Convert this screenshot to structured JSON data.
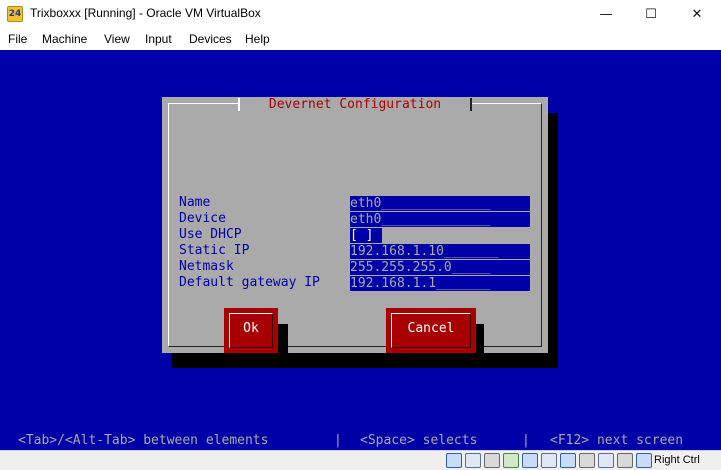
{
  "window": {
    "title": "Trixboxxx [Running] - Oracle VM VirtualBox",
    "minimize_glyph": "—",
    "maximize_glyph": "☐",
    "close_glyph": "✕",
    "icon": "virtualbox-icon",
    "icon_glyph": "24"
  },
  "menu": {
    "items": [
      "File",
      "Machine",
      "View",
      "Input",
      "Devices",
      "Help"
    ]
  },
  "dialog": {
    "title": "Devernet Configuration",
    "fields": [
      {
        "label": "Name",
        "value": "eth0______________"
      },
      {
        "label": "Device",
        "value": "eth0______________"
      },
      {
        "label": "Use DHCP",
        "value": "[ ]"
      },
      {
        "label": "Static IP",
        "value": "192.168.1.10_______"
      },
      {
        "label": "Netmask",
        "value": "255.255.255.0_____"
      },
      {
        "label": "Default gateway IP",
        "value": "192.168.1.1_______"
      }
    ],
    "buttons": {
      "ok": "Ok",
      "cancel": "Cancel"
    }
  },
  "statusline": {
    "tab_hint": "<Tab>/<Alt-Tab> between elements",
    "sep1": "|",
    "space_hint": "<Space> selects",
    "sep2": "|",
    "f12_hint": "<F12> next screen"
  },
  "vbox_status": {
    "icons": [
      "hard-disk-icon",
      "optical-drive-icon",
      "audio-icon",
      "network-icon",
      "usb-icon",
      "shared-folders-icon",
      "display-icon",
      "video-capture-icon",
      "cpu-icon",
      "mouse-integration-icon",
      "host-key-icon"
    ],
    "host_key": "Right Ctrl"
  },
  "colors": {
    "vm_background": "#0000a8",
    "dialog_gray": "#aaaaaa",
    "title_red": "#a80000",
    "button_red": "#a80000"
  }
}
